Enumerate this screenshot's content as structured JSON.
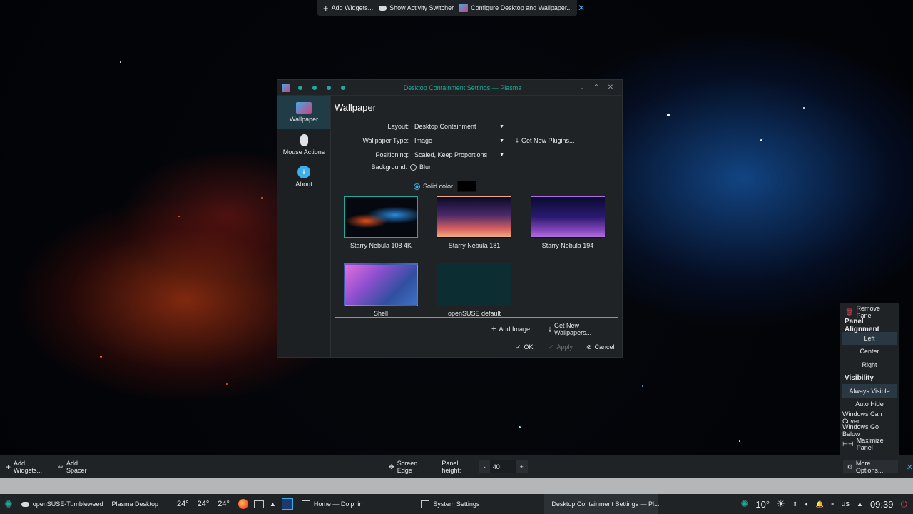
{
  "desktop_toolbar": {
    "add_widgets": "Add Widgets...",
    "activity_switcher": "Show Activity Switcher",
    "configure": "Configure Desktop and Wallpaper..."
  },
  "dialog": {
    "title": "Desktop Containment Settings — Plasma",
    "sidebar": [
      {
        "label": "Wallpaper",
        "icon": "wallpaper-icon"
      },
      {
        "label": "Mouse Actions",
        "icon": "mouse-icon"
      },
      {
        "label": "About",
        "icon": "info-icon"
      }
    ],
    "heading": "Wallpaper",
    "layout_label": "Layout:",
    "layout_value": "Desktop Containment",
    "wallpaper_type_label": "Wallpaper Type:",
    "wallpaper_type_value": "Image",
    "get_plugins": "Get New Plugins...",
    "positioning_label": "Positioning:",
    "positioning_value": "Scaled, Keep Proportions",
    "background_label": "Background:",
    "blur_label": "Blur",
    "solid_label": "Solid color",
    "solid_color": "#000000",
    "wallpapers": [
      {
        "caption": "Starry Nebula 108 4K",
        "selected": true
      },
      {
        "caption": "Starry Nebula 181",
        "selected": false
      },
      {
        "caption": "Starry Nebula 194",
        "selected": false
      },
      {
        "caption": "Shell",
        "selected": false
      },
      {
        "caption": "openSUSE default",
        "selected": false
      }
    ],
    "add_image": "Add Image...",
    "get_wallpapers": "Get New Wallpapers...",
    "ok": "OK",
    "apply": "Apply",
    "cancel": "Cancel"
  },
  "panel_popup": {
    "remove_panel": "Remove Panel",
    "alignment_heading": "Panel Alignment",
    "alignment": [
      "Left",
      "Center",
      "Right"
    ],
    "visibility_heading": "Visibility",
    "visibility": [
      "Always Visible",
      "Auto Hide",
      "Windows Can Cover",
      "Windows Go Below"
    ],
    "maximize": "Maximize Panel"
  },
  "edit_bar": {
    "add_widgets": "Add Widgets...",
    "add_spacer": "Add Spacer",
    "screen_edge": "Screen Edge",
    "panel_height_label": "Panel height:",
    "minus": "-",
    "height_value": "40",
    "plus": "+",
    "more_options": "More Options..."
  },
  "taskbar": {
    "activity": "openSUSE-Tumbleweed",
    "desktop": "Plasma Desktop",
    "temps": [
      "24°",
      "24°",
      "24°"
    ],
    "tasks": [
      "Home — Dolphin",
      "System Settings",
      "Desktop Containment Settings — Pl..."
    ],
    "weather_temp": "10°",
    "keyboard": "us",
    "clock": "09:39"
  },
  "colors": {
    "accent": "#1cab9e",
    "highlight": "#3daee9",
    "panel_bg": "#202326"
  }
}
